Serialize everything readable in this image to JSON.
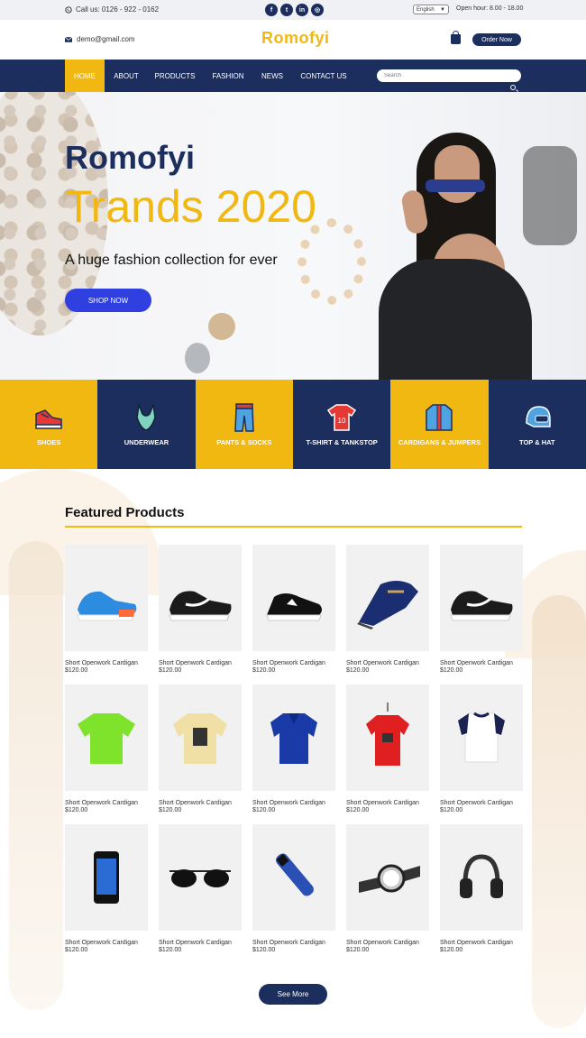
{
  "topbar": {
    "phone_label": "Call us: 0126 - 922 - 0162",
    "socials": [
      {
        "icon": "facebook-icon",
        "glyph": "f"
      },
      {
        "icon": "twitter-icon",
        "glyph": "t"
      },
      {
        "icon": "linkedin-icon",
        "glyph": "in"
      },
      {
        "icon": "instagram-icon",
        "glyph": "◎"
      }
    ],
    "language": "English",
    "hours": "Open hour: 8.00 - 18.00"
  },
  "header": {
    "email": "demo@gmail.com",
    "logo": "Romofyi",
    "order_label": "Order Now"
  },
  "nav": {
    "items": [
      "HOME",
      "ABOUT",
      "PRODUCTS",
      "FASHION",
      "NEWS",
      "CONTACT US"
    ],
    "active_index": 0,
    "search_placeholder": "Search"
  },
  "hero": {
    "brand": "Romofyi",
    "title": "Trands 2020",
    "subtitle": "A huge fashion collection for ever",
    "button": "SHOP NOW"
  },
  "categories": [
    {
      "label": "SHOES",
      "icon": "sneaker-icon",
      "color": "yellow"
    },
    {
      "label": "UNDERWEAR",
      "icon": "swimsuit-icon",
      "color": "blue"
    },
    {
      "label": "PANTS & SOCKS",
      "icon": "pants-icon",
      "color": "yellow"
    },
    {
      "label": "T-SHIRT & TANKSTOP",
      "icon": "jersey-icon",
      "color": "blue"
    },
    {
      "label": "CARDIGANS & JUMPERS",
      "icon": "jacket-icon",
      "color": "yellow"
    },
    {
      "label": "TOP & HAT",
      "icon": "helmet-icon",
      "color": "blue"
    }
  ],
  "featured": {
    "title": "Featured Products",
    "products": [
      {
        "name": "Short Openwork Cardigan",
        "price": "$120.00",
        "icon": "blue-running-shoe-icon"
      },
      {
        "name": "Short Openwork Cardigan",
        "price": "$120.00",
        "icon": "black-sneaker-icon"
      },
      {
        "name": "Short Openwork Cardigan",
        "price": "$120.00",
        "icon": "black-canvas-shoe-icon"
      },
      {
        "name": "Short Openwork Cardigan",
        "price": "$120.00",
        "icon": "navy-loafer-icon"
      },
      {
        "name": "Short Openwork Cardigan",
        "price": "$120.00",
        "icon": "black-sneaker-icon"
      },
      {
        "name": "Short Openwork Cardigan",
        "price": "$120.00",
        "icon": "green-tshirt-icon"
      },
      {
        "name": "Short Openwork Cardigan",
        "price": "$120.00",
        "icon": "beige-tshirt-icon"
      },
      {
        "name": "Short Openwork Cardigan",
        "price": "$120.00",
        "icon": "blue-polo-icon"
      },
      {
        "name": "Short Openwork Cardigan",
        "price": "$120.00",
        "icon": "red-tshirt-icon"
      },
      {
        "name": "Short Openwork Cardigan",
        "price": "$120.00",
        "icon": "raglan-tshirt-icon"
      },
      {
        "name": "Short Openwork Cardigan",
        "price": "$120.00",
        "icon": "smartphone-icon"
      },
      {
        "name": "Short Openwork Cardigan",
        "price": "$120.00",
        "icon": "sunglasses-icon"
      },
      {
        "name": "Short Openwork Cardigan",
        "price": "$120.00",
        "icon": "hair-trimmer-icon"
      },
      {
        "name": "Short Openwork Cardigan",
        "price": "$120.00",
        "icon": "wristwatch-icon"
      },
      {
        "name": "Short Openwork Cardigan",
        "price": "$120.00",
        "icon": "headphones-icon"
      }
    ],
    "see_more": "See More"
  },
  "colors": {
    "navy": "#1c2e5e",
    "yellow": "#f1b811",
    "shop_button": "#2f3fe0"
  }
}
